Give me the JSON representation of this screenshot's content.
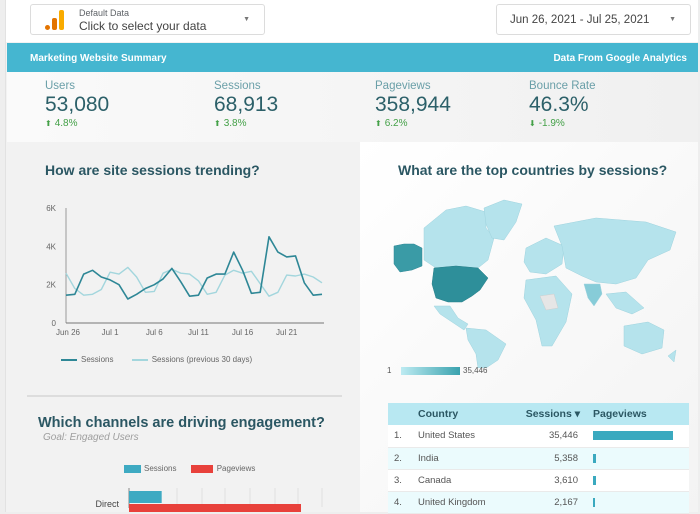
{
  "data_source": {
    "title": "Default Data",
    "placeholder": "Click to select your data",
    "logo_icon": "google-analytics-logo"
  },
  "date_range": {
    "label": "Jun 26, 2021 - Jul 25, 2021"
  },
  "banner": {
    "left": "Marketing Website Summary",
    "right": "Data From Google Analytics",
    "color": "#45b6d0"
  },
  "kpis": [
    {
      "label": "Users",
      "value": "53,080",
      "change": "4.8%",
      "direction": "up"
    },
    {
      "label": "Sessions",
      "value": "68,913",
      "change": "3.8%",
      "direction": "up"
    },
    {
      "label": "Pageviews",
      "value": "358,944",
      "change": "6.2%",
      "direction": "up"
    },
    {
      "label": "Bounce Rate",
      "value": "46.3%",
      "change": "-1.9%",
      "direction": "down"
    }
  ],
  "arrows": {
    "up": "⬆",
    "down": "⬇"
  },
  "trend": {
    "title": "How are site sessions trending?",
    "legend": [
      "Sessions",
      "Sessions (previous 30 days)"
    ]
  },
  "map": {
    "title": "What are the top countries by sessions?",
    "scale_min": "1",
    "scale_max": "35,446"
  },
  "channels": {
    "title": "Which channels are driving engagement?",
    "subtitle": "Goal: Engaged Users",
    "legend": [
      "Sessions",
      "Pageviews"
    ],
    "categories_visible": [
      "Direct"
    ]
  },
  "country_table": {
    "headers": [
      "Country",
      "Sessions ▾",
      "Pageviews"
    ],
    "rows": [
      {
        "rank": "1.",
        "country": "United States",
        "sessions": "35,446",
        "pageviews_ratio": 1.0
      },
      {
        "rank": "2.",
        "country": "India",
        "sessions": "5,358",
        "pageviews_ratio": 0.04
      },
      {
        "rank": "3.",
        "country": "Canada",
        "sessions": "3,610",
        "pageviews_ratio": 0.04
      },
      {
        "rank": "4.",
        "country": "United Kingdom",
        "sessions": "2,167",
        "pageviews_ratio": 0.02
      }
    ]
  },
  "chart_data": [
    {
      "type": "line",
      "title": "How are site sessions trending?",
      "xlabel": "",
      "ylabel": "",
      "ylim": [
        0,
        6000
      ],
      "yticks": [
        "0",
        "2K",
        "4K",
        "6K"
      ],
      "ytick_values": [
        0,
        2000,
        4000,
        6000
      ],
      "xticks": [
        "Jun 26",
        "Jul 1",
        "Jul 6",
        "Jul 11",
        "Jul 16",
        "Jul 21"
      ],
      "xtick_index": [
        0,
        5,
        10,
        15,
        20,
        25
      ],
      "grid": false,
      "legend_position": "bottom",
      "series": [
        {
          "name": "Sessions",
          "color": "#2e8796",
          "values": [
            1450,
            1500,
            2550,
            2750,
            2400,
            2250,
            2000,
            1250,
            1500,
            1800,
            2000,
            2300,
            2850,
            2150,
            1400,
            1450,
            2350,
            2550,
            2550,
            3700,
            2750,
            1550,
            1600,
            4500,
            3700,
            3450,
            3500,
            2100,
            1450,
            1500
          ]
        },
        {
          "name": "Sessions (previous 30 days)",
          "color": "#a3d6dd",
          "values": [
            2600,
            1800,
            1450,
            1500,
            1750,
            2650,
            2550,
            2900,
            2400,
            1600,
            1650,
            2600,
            2800,
            2600,
            2550,
            2200,
            1500,
            1600,
            2500,
            2750,
            2600,
            2700,
            2050,
            1400,
            1600,
            2500,
            2450,
            2550,
            2400,
            2100
          ]
        }
      ]
    },
    {
      "type": "bar",
      "title": "Which channels are driving engagement?",
      "subtitle": "Goal: Engaged Users",
      "orientation": "horizontal",
      "categories": [
        "Direct"
      ],
      "legend_position": "top",
      "series": [
        {
          "name": "Sessions",
          "color": "#3eaac2",
          "values": [
            0.19
          ]
        },
        {
          "name": "Pageviews",
          "color": "#e8413b",
          "values": [
            1.0
          ]
        }
      ]
    }
  ]
}
